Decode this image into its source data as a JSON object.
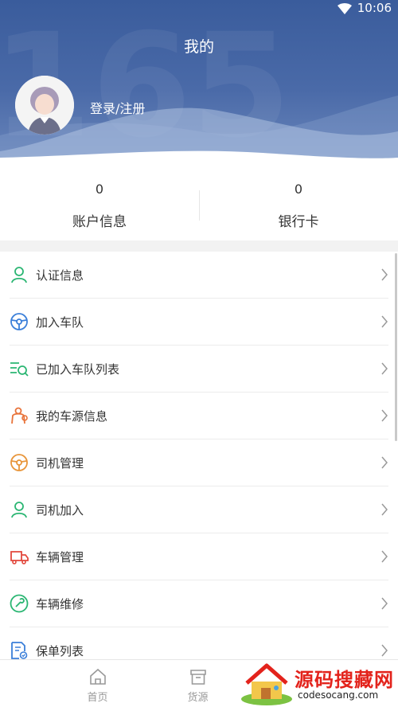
{
  "status_bar": {
    "time": "10:06"
  },
  "header": {
    "title": "我的",
    "login_label": "登录/注册",
    "bg_watermark": "165"
  },
  "stats": [
    {
      "value": "0",
      "label": "账户信息"
    },
    {
      "value": "0",
      "label": "银行卡"
    }
  ],
  "menu": [
    {
      "label": "认证信息",
      "icon": "person-icon",
      "color": "#2bb673"
    },
    {
      "label": "加入车队",
      "icon": "steering-wheel-icon",
      "color": "#3b7fd9"
    },
    {
      "label": "已加入车队列表",
      "icon": "list-search-icon",
      "color": "#2bb673"
    },
    {
      "label": "我的车源信息",
      "icon": "person-pin-icon",
      "color": "#e8733a"
    },
    {
      "label": "司机管理",
      "icon": "steering-wheel-icon",
      "color": "#e8953a"
    },
    {
      "label": "司机加入",
      "icon": "person-icon",
      "color": "#2bb673"
    },
    {
      "label": "车辆管理",
      "icon": "truck-icon",
      "color": "#e2483d"
    },
    {
      "label": "车辆维修",
      "icon": "wrench-icon",
      "color": "#2bb673"
    },
    {
      "label": "保单列表",
      "icon": "document-icon",
      "color": "#3b7fd9"
    }
  ],
  "tabs": [
    {
      "label": "首页",
      "icon": "home-icon"
    },
    {
      "label": "货源",
      "icon": "box-icon"
    }
  ],
  "watermark": {
    "title": "源码搜藏网",
    "url": "codesocang.com"
  }
}
